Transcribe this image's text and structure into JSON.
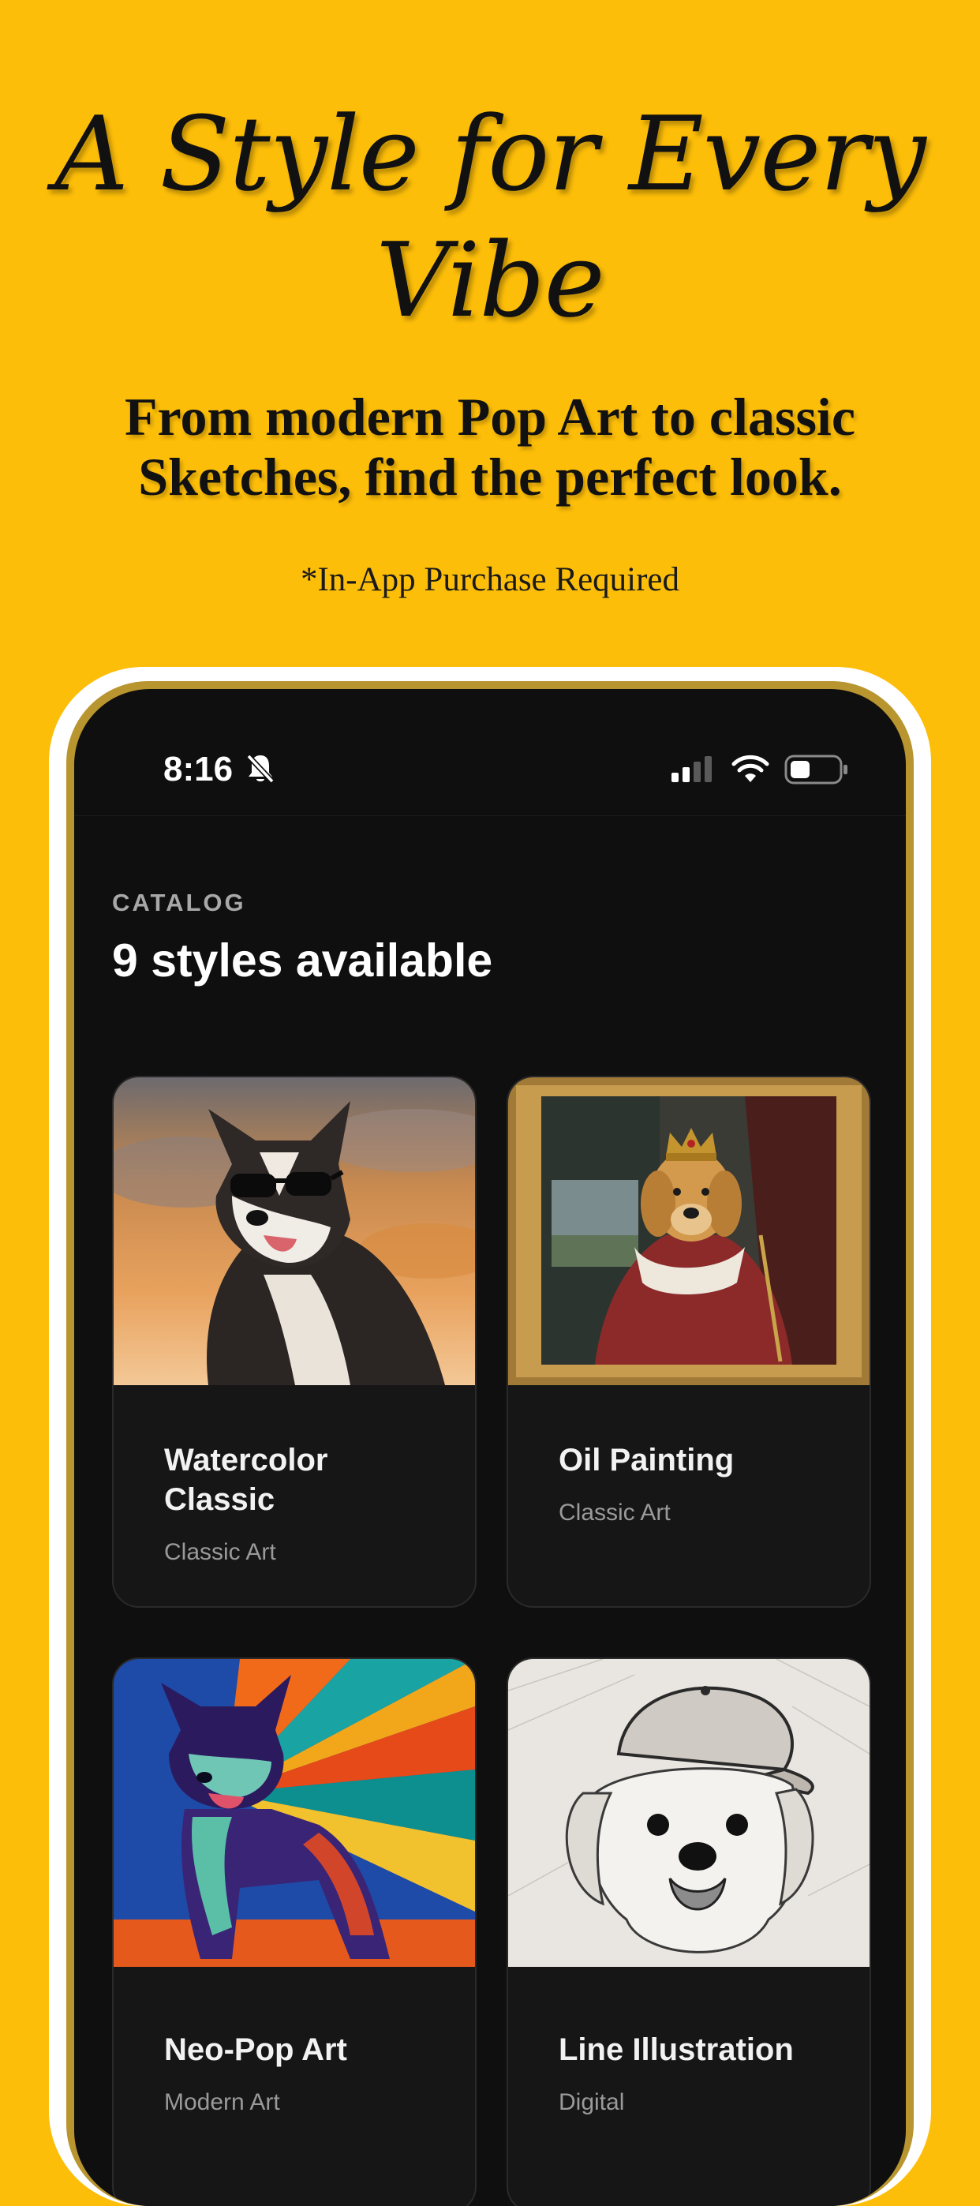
{
  "promo": {
    "title_line1": "A Style for Every",
    "title_line2": "Vibe",
    "subtitle_line1": "From modern Pop Art to classic",
    "subtitle_line2": "Sketches, find the perfect look.",
    "disclaimer": "*In-App Purchase Required"
  },
  "status_bar": {
    "time": "8:16",
    "icons": [
      "bell-slash-icon",
      "signal-icon",
      "wifi-icon",
      "battery-icon"
    ]
  },
  "catalog": {
    "label": "CATALOG",
    "count_text": "9 styles available",
    "cards": [
      {
        "title_line1": "Watercolor",
        "title_line2": "Classic",
        "category": "Classic Art"
      },
      {
        "title_line1": "Oil Painting",
        "title_line2": "",
        "category": "Classic Art"
      },
      {
        "title_line1": "Neo-Pop Art",
        "title_line2": "",
        "category": "Modern Art"
      },
      {
        "title_line1": "Line Illustration",
        "title_line2": "",
        "category": "Digital"
      }
    ]
  },
  "colors": {
    "background": "#FDBE09",
    "device_frame": "#FFFFFF",
    "device_bezel": "#B8952F",
    "screen": "#0F0F0F",
    "card": "#161616"
  }
}
